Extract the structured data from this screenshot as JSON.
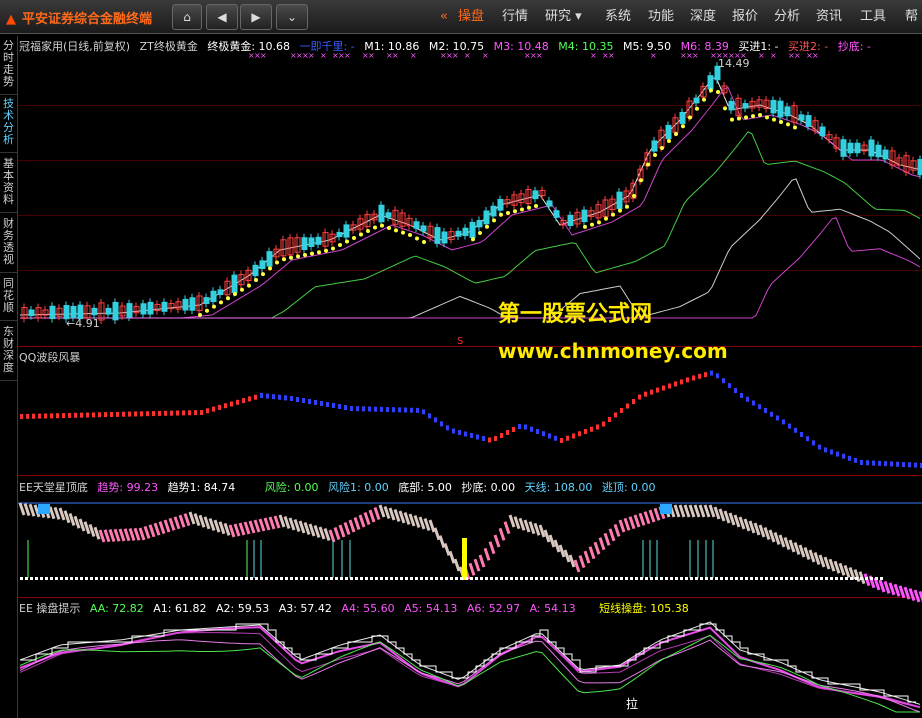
{
  "app": {
    "title": "平安证券综合金融终端"
  },
  "nav_buttons": {
    "home": "⌂",
    "back": "◀",
    "forward": "▶",
    "more": "⌄"
  },
  "menu": [
    {
      "label": "操盘",
      "active": true
    },
    {
      "label": "行情"
    },
    {
      "label": "研究 ▾"
    },
    {
      "label": "系统"
    },
    {
      "label": "功能"
    },
    {
      "label": "深度"
    },
    {
      "label": "报价"
    },
    {
      "label": "分析"
    },
    {
      "label": "资讯"
    },
    {
      "label": "工具"
    },
    {
      "label": "帮"
    }
  ],
  "sidebar": [
    {
      "label": "分时走势"
    },
    {
      "label": "技术分析",
      "active": true
    },
    {
      "label": "基本资料"
    },
    {
      "label": "财务透视"
    },
    {
      "label": "同花顺"
    },
    {
      "label": "东财深度"
    }
  ],
  "main_header": {
    "stock": "冠福家用(日线,前复权)",
    "indicator": "ZT终极黄金",
    "items": [
      {
        "label": "终极黄金: 10.68",
        "color": "#ffffff"
      },
      {
        "label": "一即千里: -",
        "color": "#3b5bff"
      },
      {
        "label": "M1: 10.86",
        "color": "#ffffff"
      },
      {
        "label": "M2: 10.75",
        "color": "#ffffff"
      },
      {
        "label": "M3: 10.48",
        "color": "#ff55ff"
      },
      {
        "label": "M4: 10.35",
        "color": "#55ff55"
      },
      {
        "label": "M5: 9.50",
        "color": "#ffffff"
      },
      {
        "label": "M6: 8.39",
        "color": "#ff55ff"
      },
      {
        "label": "买进1: -",
        "color": "#ffffff"
      },
      {
        "label": "买进2: -",
        "color": "#ff5555"
      },
      {
        "label": "抄底: -",
        "color": "#ff55ff"
      }
    ],
    "high_label": "14.49",
    "low_label": "←4.91",
    "marker": "S"
  },
  "watermark": {
    "line1": "第一股票公式网",
    "line2": "www.chnmoney.com"
  },
  "qq_panel": {
    "title": "QQ波段风暴"
  },
  "ee_panel": {
    "title": "EE天堂星顶底",
    "items": [
      {
        "label": "趋势: 99.23",
        "color": "#ff55ff"
      },
      {
        "label": "趋势1: 84.74",
        "color": "#ffffff"
      },
      {
        "label": "风险: 0.00",
        "color": "#55ff55"
      },
      {
        "label": "风险1: 0.00",
        "color": "#5fd3ff"
      },
      {
        "label": "底部: 5.00",
        "color": "#ffffff"
      },
      {
        "label": "抄底: 0.00",
        "color": "#ffffff"
      },
      {
        "label": "天线: 108.00",
        "color": "#5fd3ff"
      },
      {
        "label": "逃顶: 0.00",
        "color": "#5fd3ff"
      }
    ]
  },
  "cp_panel": {
    "title": "EE 操盘提示",
    "items": [
      {
        "label": "AA: 72.82",
        "color": "#55ff55"
      },
      {
        "label": "A1: 61.82",
        "color": "#ffffff"
      },
      {
        "label": "A2: 59.53",
        "color": "#ffffff"
      },
      {
        "label": "A3: 57.42",
        "color": "#ffffff"
      },
      {
        "label": "A4: 55.60",
        "color": "#ff55ff"
      },
      {
        "label": "A5: 54.13",
        "color": "#ff55ff"
      },
      {
        "label": "A6: 52.97",
        "color": "#ff55ff"
      },
      {
        "label": "A: 54.13",
        "color": "#ff55ff"
      },
      {
        "label": "短线操盘: 105.38",
        "color": "#ffff00"
      }
    ],
    "bottom_label": "拉"
  }
}
